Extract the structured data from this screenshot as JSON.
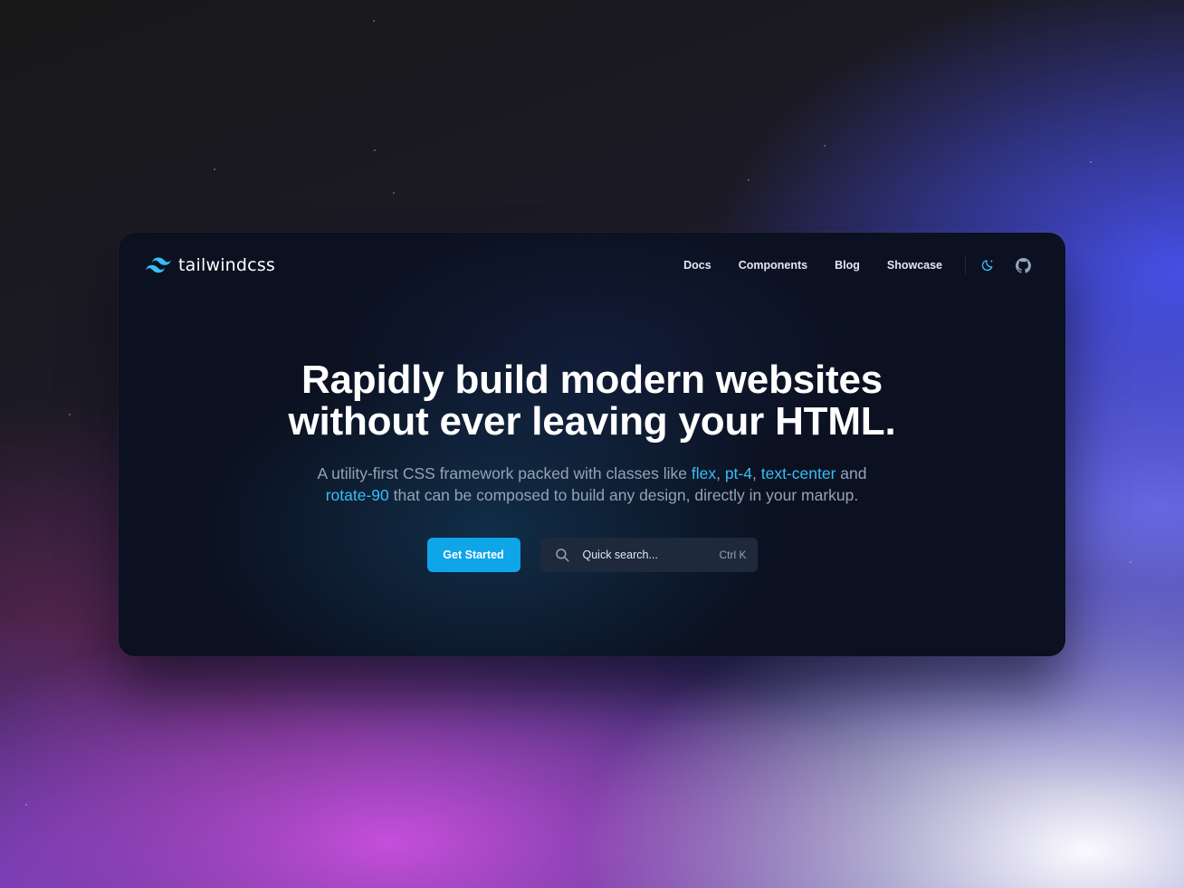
{
  "brand": {
    "name": "tailwindcss",
    "logo_icon": "tailwind-wave-icon",
    "accent_color": "#38bdf8"
  },
  "nav": {
    "links": [
      "Docs",
      "Components",
      "Blog",
      "Showcase"
    ],
    "theme_toggle_icon": "moon-sparkle-icon",
    "github_icon": "github-icon"
  },
  "hero": {
    "headline_line1": "Rapidly build modern websites",
    "headline_line2": "without ever leaving your HTML.",
    "sub_part1": "A utility-first CSS framework packed with classes like ",
    "code1": "flex",
    "sep1": ", ",
    "code2": "pt-4",
    "sep2": ", ",
    "code3": "text-center",
    "sub_part2": " and",
    "code4": "rotate-90",
    "sub_part3": " that can be composed to build any design, directly in your markup."
  },
  "actions": {
    "primary_label": "Get Started",
    "primary_color": "#0ea5e9",
    "search_placeholder": "Quick search...",
    "search_shortcut": "Ctrl K",
    "search_icon": "search-icon"
  }
}
